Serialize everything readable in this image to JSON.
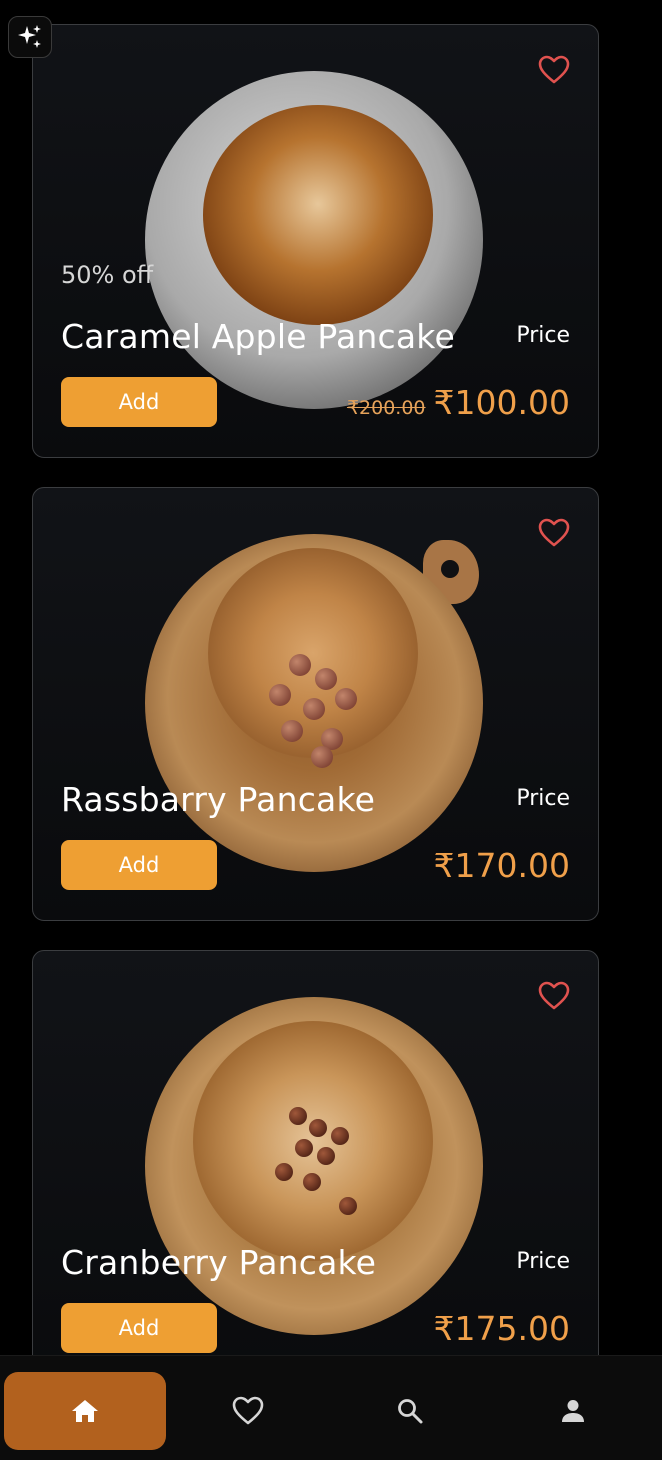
{
  "icons": {
    "sparkle": "sparkle-icon",
    "favorite": "heart-outline-icon",
    "home": "home-icon",
    "nav_favorite": "heart-outline-icon",
    "search": "search-icon",
    "profile": "person-icon"
  },
  "colors": {
    "accent": "#ee9f33",
    "price": "#f0a04a",
    "heart": "#e0524f",
    "nav_active": "#b2611e",
    "card_border": "#3b3d40"
  },
  "products": [
    {
      "discount": "50% off",
      "name": "Caramel Apple Pancake",
      "price_label": "Price",
      "add_label": "Add",
      "old_price": "₹200.00",
      "price": "₹100.00"
    },
    {
      "name": "Rassbarry Pancake",
      "price_label": "Price",
      "add_label": "Add",
      "price": "₹170.00"
    },
    {
      "name": "Cranberry Pancake",
      "price_label": "Price",
      "add_label": "Add",
      "price": "₹175.00"
    }
  ]
}
